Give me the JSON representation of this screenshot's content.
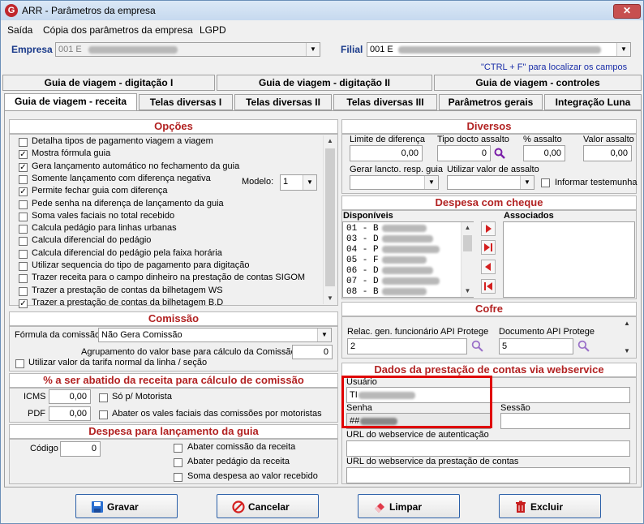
{
  "window": {
    "title": "ARR - Parâmetros da empresa",
    "app_icon": "G",
    "close_symbol": "✕"
  },
  "menu": [
    {
      "label": "Saída",
      "underline": "S"
    },
    {
      "label": "Cópia dos parâmetros da empresa",
      "underline": "C"
    },
    {
      "label": "LGPD",
      "underline": "L"
    }
  ],
  "empresa": {
    "label": "Empresa",
    "value": "001 E"
  },
  "filial": {
    "label": "Filial",
    "value": "001 E"
  },
  "hint": "\"CTRL + F\" para localizar os campos",
  "tabs_row1": [
    "Guia de viagem - digitação I",
    "Guia de viagem - digitação II",
    "Guia de viagem - controles"
  ],
  "tabs_row2": [
    "Guia de viagem - receita",
    "Telas diversas I",
    "Telas diversas II",
    "Telas diversas III",
    "Parâmetros gerais",
    "Integração Luna"
  ],
  "active_tab": "Guia de viagem - receita",
  "opcoes": {
    "title": "Opções",
    "modelo_label": "Modelo:",
    "modelo_value": "1",
    "items": [
      {
        "label": "Detalha tipos de pagamento viagem a viagem",
        "checked": false
      },
      {
        "label": "Mostra fórmula guia",
        "checked": true
      },
      {
        "label": "Gera lançamento automático no fechamento da guia",
        "checked": true
      },
      {
        "label": "Somente lançamento com diferença negativa",
        "checked": false
      },
      {
        "label": "Permite fechar guia com diferença",
        "checked": true
      },
      {
        "label": "Pede senha na diferença de lançamento da guia",
        "checked": false
      },
      {
        "label": "Soma vales faciais no total recebido",
        "checked": false
      },
      {
        "label": "Calcula pedágio para linhas urbanas",
        "checked": false
      },
      {
        "label": "Calcula diferencial do pedágio",
        "checked": false
      },
      {
        "label": "Calcula diferencial do pedágio pela faixa horária",
        "checked": false
      },
      {
        "label": "Utilizar sequencia do tipo de pagamento para digitação",
        "checked": false
      },
      {
        "label": "Trazer receita para o campo dinheiro na prestação de contas SIGOM",
        "checked": false
      },
      {
        "label": "Trazer a prestação de contas da bilhetagem WS",
        "checked": false
      },
      {
        "label": "Trazer a prestação de contas da bilhetagem B.D",
        "checked": true
      }
    ]
  },
  "comissao": {
    "title": "Comissão",
    "formula_label": "Fórmula da comissão",
    "formula_value": "Não Gera Comissão",
    "agrupamento_label": "Agrupamento do valor base para cálculo da Comissão",
    "agrupamento_value": "0",
    "tarifa_label": "Utilizar valor da tarifa normal da linha / seção"
  },
  "abatido": {
    "title": "% a ser abatido da receita para cálculo de comissão",
    "icms_label": "ICMS",
    "icms_value": "0,00",
    "pdf_label": "PDF",
    "pdf_value": "0,00",
    "motorista_label": "Só p/ Motorista",
    "vales_label": "Abater os vales faciais das comissões por motoristas"
  },
  "despesa_lancamento": {
    "title": "Despesa para lançamento da guia",
    "codigo_label": "Código",
    "codigo_value": "0",
    "checks": [
      "Abater comissão da receita",
      "Abater pedágio da receita",
      "Soma despesa ao valor recebido"
    ]
  },
  "diversos": {
    "title": "Diversos",
    "limite_label": "Limite de diferença",
    "limite_value": "0,00",
    "tipo_label": "Tipo docto assalto",
    "tipo_value": "0",
    "pct_label": "% assalto",
    "pct_value": "0,00",
    "valor_label": "Valor assalto",
    "valor_value": "0,00",
    "gerar_label": "Gerar lancto. resp. guia",
    "utilizar_label": "Utilizar valor de assalto",
    "informar_label": "Informar testemunha"
  },
  "cheque": {
    "title": "Despesa com cheque",
    "disponiveis_label": "Disponíveis",
    "associados_label": "Associados",
    "items": [
      "01 - B",
      "03 - D",
      "04 - P",
      "05 - F",
      "06 - D",
      "07 - D",
      "08 - B"
    ]
  },
  "cofre": {
    "title": "Cofre",
    "relac_label": "Relac. gen. funcionário API Protege",
    "relac_value": "2",
    "doc_label": "Documento API Protege",
    "doc_value": "5"
  },
  "webservice": {
    "title": "Dados da prestação de contas via webservice",
    "usuario_label": "Usuário",
    "usuario_value": "TI",
    "senha_label": "Senha",
    "senha_value": "##",
    "sessao_label": "Sessão",
    "url_auth_label": "URL do webservice de autenticação",
    "url_prest_label": "URL do webservice da prestação de contas"
  },
  "buttons": {
    "gravar": "Gravar",
    "cancelar": "Cancelar",
    "limpar": "Limpar",
    "excluir": "Excluir"
  },
  "colors": {
    "panel_title": "#b22222",
    "label_blue": "#1a3a8a",
    "highlight": "#e00000"
  }
}
